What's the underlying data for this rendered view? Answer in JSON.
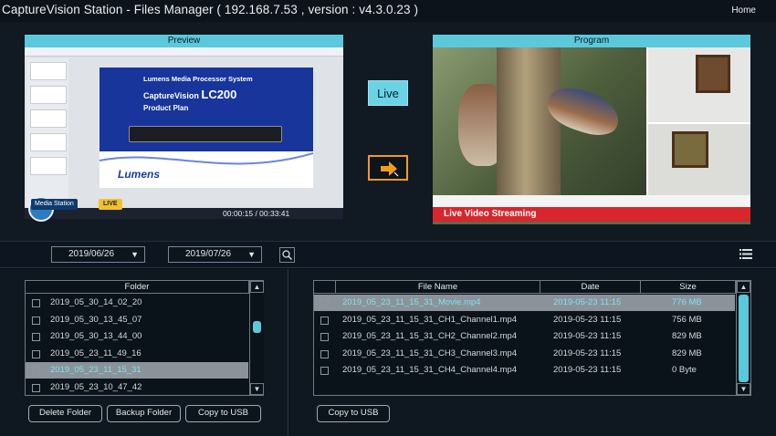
{
  "header": {
    "title": "CaptureVision Station - Files Manager ( 192.168.7.53 , version : v4.3.0.23 )",
    "home_label": "Home"
  },
  "preview": {
    "label": "Preview",
    "slide_line1": "Lumens Media Processor System",
    "slide_line2_prefix": "CaptureVision",
    "slide_line2_model": "LC200",
    "slide_line3": "Product Plan",
    "slide_logo": "Lumens",
    "media_station_label": "Media Station",
    "live_tag": "LIVE",
    "play_time": "00:00:15 / 00:33:41"
  },
  "controls": {
    "live_label": "Live",
    "transfer_icon": "arrow-right-icon"
  },
  "program": {
    "label": "Program",
    "stream_banner": "Live Video Streaming"
  },
  "filter": {
    "start_date": "2019/06/26",
    "end_date": "2019/07/26",
    "search_icon": "search-icon",
    "view_icon": "list-view-icon"
  },
  "folders": {
    "header": "Folder",
    "items": [
      {
        "name": "2019_05_30_14_02_20",
        "selected": false
      },
      {
        "name": "2019_05_30_13_45_07",
        "selected": false
      },
      {
        "name": "2019_05_30_13_44_00",
        "selected": false
      },
      {
        "name": "2019_05_23_11_49_16",
        "selected": false
      },
      {
        "name": "2019_05_23_11_15_31",
        "selected": true
      },
      {
        "name": "2019_05_23_10_47_42",
        "selected": false
      }
    ],
    "buttons": {
      "delete": "Delete Folder",
      "backup": "Backup Folder",
      "copy": "Copy to USB"
    }
  },
  "files": {
    "headers": {
      "name": "File Name",
      "date": "Date",
      "size": "Size"
    },
    "rows": [
      {
        "name": "2019_05_23_11_15_31_Movie.mp4",
        "date": "2019-05-23 11:15",
        "size": "776 MB",
        "selected": true
      },
      {
        "name": "2019_05_23_11_15_31_CH1_Channel1.mp4",
        "date": "2019-05-23 11:15",
        "size": "756 MB",
        "selected": false
      },
      {
        "name": "2019_05_23_11_15_31_CH2_Channel2.mp4",
        "date": "2019-05-23 11:15",
        "size": "829 MB",
        "selected": false
      },
      {
        "name": "2019_05_23_11_15_31_CH3_Channel3.mp4",
        "date": "2019-05-23 11:15",
        "size": "829 MB",
        "selected": false
      },
      {
        "name": "2019_05_23_11_15_31_CH4_Channel4.mp4",
        "date": "2019-05-23 11:15",
        "size": "0 Byte",
        "selected": false
      }
    ],
    "buttons": {
      "copy": "Copy to USB"
    }
  },
  "colors": {
    "accent": "#5cc8dc",
    "arrow_border": "#f39a1a",
    "stream_banner": "#d8262d"
  }
}
